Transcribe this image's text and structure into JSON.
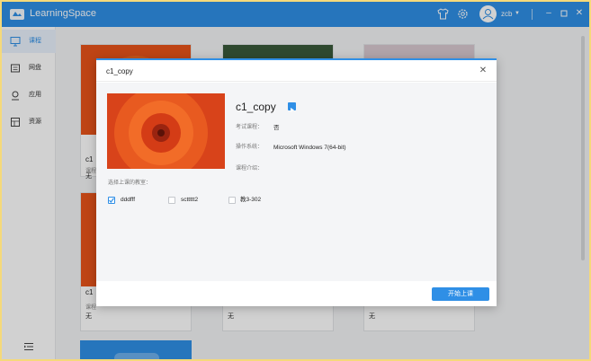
{
  "app": {
    "title": "LearningSpace",
    "user": "zcb",
    "accent": "#2f8fe6"
  },
  "sidebar": {
    "items": [
      {
        "label": "课程",
        "icon": "courses-icon",
        "active": true
      },
      {
        "label": "网盘",
        "icon": "cloud-drive-icon"
      },
      {
        "label": "应用",
        "icon": "apps-icon"
      },
      {
        "label": "资源",
        "icon": "resources-icon"
      }
    ]
  },
  "cards": [
    {
      "title": "c1",
      "sub": "课程",
      "value": "无"
    },
    {
      "title": "c1",
      "sub": "课程",
      "value": "无"
    },
    {
      "title": "",
      "sub": "",
      "value": "无"
    },
    {
      "title": "",
      "sub": "",
      "value": "无"
    }
  ],
  "dialog": {
    "header_title": "c1_copy",
    "course_name": "c1_copy",
    "exam_label": "考试课程：",
    "exam_value": "否",
    "os_label": "操作系统：",
    "os_value": "Microsoft Windows 7(64-bit)",
    "intro_label": "课程介绍：",
    "classroom_title": "选择上课的教室：",
    "classrooms": [
      {
        "name": "dddfff",
        "checked": true
      },
      {
        "name": "scttttt2",
        "checked": false
      },
      {
        "name": "教3-302",
        "checked": false
      }
    ],
    "start_button": "开始上课"
  }
}
